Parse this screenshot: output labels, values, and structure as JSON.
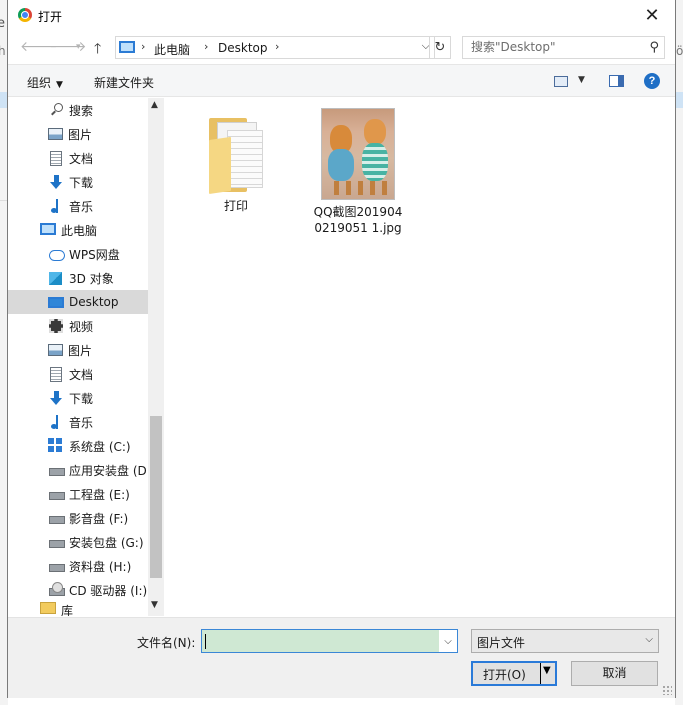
{
  "window": {
    "title": "打开"
  },
  "nav": {
    "crumbs": [
      "此电脑",
      "Desktop"
    ],
    "search_placeholder": "搜索\"Desktop\""
  },
  "toolbar": {
    "organize": "组织",
    "new_folder": "新建文件夹"
  },
  "sidebar": {
    "items": [
      {
        "label": "搜索",
        "icon": "search-icon"
      },
      {
        "label": "图片",
        "icon": "pictures-icon"
      },
      {
        "label": "文档",
        "icon": "documents-icon"
      },
      {
        "label": "下载",
        "icon": "downloads-icon"
      },
      {
        "label": "音乐",
        "icon": "music-icon"
      },
      {
        "label": "此电脑",
        "icon": "this-pc-icon"
      },
      {
        "label": "WPS网盘",
        "icon": "cloud-icon"
      },
      {
        "label": "3D 对象",
        "icon": "3d-objects-icon"
      },
      {
        "label": "Desktop",
        "icon": "desktop-icon",
        "selected": true
      },
      {
        "label": "视频",
        "icon": "videos-icon"
      },
      {
        "label": "图片",
        "icon": "pictures-icon"
      },
      {
        "label": "文档",
        "icon": "documents-icon"
      },
      {
        "label": "下载",
        "icon": "downloads-icon"
      },
      {
        "label": "音乐",
        "icon": "music-icon"
      },
      {
        "label": "系统盘 (C:)",
        "icon": "windows-drive-icon"
      },
      {
        "label": "应用安装盘 (D",
        "icon": "drive-icon"
      },
      {
        "label": "工程盘 (E:)",
        "icon": "drive-icon"
      },
      {
        "label": "影音盘 (F:)",
        "icon": "drive-icon"
      },
      {
        "label": "安装包盘 (G:)",
        "icon": "drive-icon"
      },
      {
        "label": "资料盘 (H:)",
        "icon": "drive-icon"
      },
      {
        "label": "CD 驱动器 (I:)",
        "icon": "cd-drive-icon"
      },
      {
        "label": "库",
        "icon": "library-icon"
      }
    ]
  },
  "files": [
    {
      "name": "打印",
      "type": "folder"
    },
    {
      "name": "QQ截图2019040219051 1.jpg",
      "type": "image"
    }
  ],
  "footer": {
    "filename_label": "文件名(N):",
    "filename_value": "",
    "filetype_value": "图片文件",
    "open_label": "打开(O)",
    "cancel_label": "取消"
  },
  "colors": {
    "accent": "#2a7ad8",
    "selection": "#d9d9d9",
    "filename_field": "#cfe8d3"
  }
}
